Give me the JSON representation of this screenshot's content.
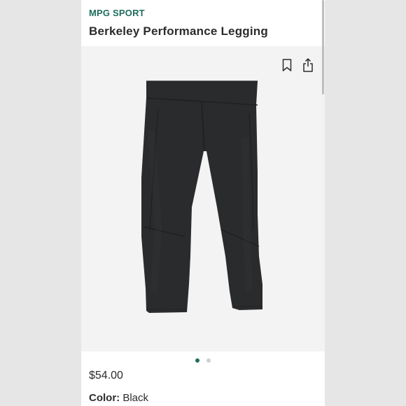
{
  "product": {
    "brand": "MPG SPORT",
    "title": "Berkeley Performance Legging",
    "price": "$54.00",
    "color_label": "Color:",
    "color_value": "Black"
  },
  "gallery": {
    "current_index": 1,
    "total": 2
  },
  "icons": {
    "save": "bookmark-icon",
    "share": "share-icon"
  },
  "colors": {
    "brand": "#1f6d5e",
    "text": "#2c2c2c",
    "garment": "#2a2b2d",
    "image_bg": "#f3f3f3"
  }
}
